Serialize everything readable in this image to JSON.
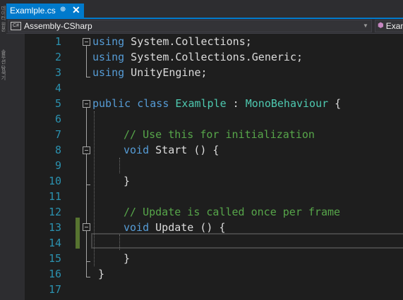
{
  "tab": {
    "title": "Examlple.cs",
    "pin": "⊕",
    "close": "✕"
  },
  "left_strip": {
    "top_text": "데이터 원본",
    "lower_text": "솔루션 탐색기"
  },
  "nav": {
    "project": "Assembly-CSharp",
    "project_icon": "C#",
    "member": "Exam"
  },
  "colors": {
    "accent": "#007acc",
    "keyword": "#569cd6",
    "type": "#4ec9b0",
    "comment": "#57a64a",
    "line_number": "#2b91af",
    "changed": "#577430"
  },
  "editor": {
    "line_numbers": [
      "1",
      "2",
      "3",
      "4",
      "5",
      "6",
      "7",
      "8",
      "9",
      "10",
      "11",
      "12",
      "13",
      "14",
      "15",
      "16",
      "17"
    ],
    "lines": {
      "l1": {
        "kw": "using",
        "rest": " System.Collections;"
      },
      "l2": {
        "kw": "using",
        "rest": " System.Collections.Generic;"
      },
      "l3": {
        "kw": "using",
        "rest": " UnityEngine;"
      },
      "l5": {
        "kw1": "public",
        "kw2": "class",
        "type": "Examlple",
        "colon": " : ",
        "base": "MonoBehaviour",
        "brace": " {"
      },
      "l7": {
        "comment": "// Use this for initialization"
      },
      "l8": {
        "kw": "void",
        "rest": " Start () {"
      },
      "l10": {
        "brace": "}"
      },
      "l12": {
        "comment": "// Update is called once per frame"
      },
      "l13": {
        "kw": "void",
        "rest": " Update () {"
      },
      "l15": {
        "brace": "}"
      },
      "l16": {
        "brace": "}"
      }
    }
  }
}
